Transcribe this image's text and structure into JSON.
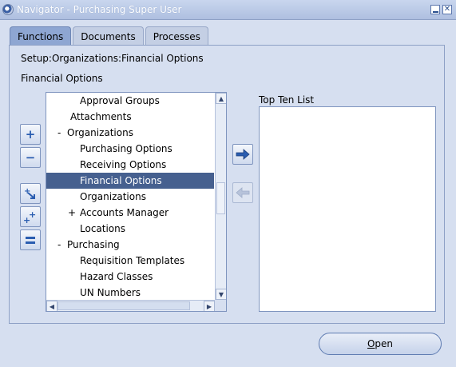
{
  "window": {
    "title": "Navigator - Purchasing Super User",
    "minimize_icon": "minimize-icon",
    "close_icon": "close-icon"
  },
  "tabs": [
    {
      "label": "Functions",
      "active": true
    },
    {
      "label": "Documents",
      "active": false
    },
    {
      "label": "Processes",
      "active": false
    }
  ],
  "breadcrumb": "Setup:Organizations:Financial Options",
  "section_label": "Financial Options",
  "side_buttons": [
    {
      "icon": "expand-plus-icon"
    },
    {
      "icon": "collapse-minus-icon"
    },
    {
      "icon": "expand-branch-icon"
    },
    {
      "icon": "expand-all-icon"
    },
    {
      "icon": "collapse-all-icon"
    }
  ],
  "tree": {
    "items": [
      {
        "label": "Approval Groups",
        "expander": ""
      },
      {
        "label": "Attachments",
        "expander": ""
      },
      {
        "label": "Organizations",
        "expander": "-"
      },
      {
        "label": "Purchasing Options",
        "expander": ""
      },
      {
        "label": "Receiving Options",
        "expander": ""
      },
      {
        "label": "Financial Options",
        "expander": "",
        "selected": true
      },
      {
        "label": "Organizations",
        "expander": ""
      },
      {
        "label": "Accounts Manager",
        "expander": "+"
      },
      {
        "label": "Locations",
        "expander": ""
      },
      {
        "label": "Purchasing",
        "expander": "-"
      },
      {
        "label": "Requisition Templates",
        "expander": ""
      },
      {
        "label": "Hazard Classes",
        "expander": ""
      },
      {
        "label": "UN Numbers",
        "expander": ""
      }
    ]
  },
  "add_to_list_icon": "arrow-right-icon",
  "remove_from_list_icon": "arrow-left-icon",
  "top_ten": {
    "label": "Top Ten List",
    "items": []
  },
  "open_button": {
    "mnemonic": "O",
    "rest": "pen"
  },
  "colors": {
    "background": "#d6dff0",
    "selected_row": "#46608f",
    "active_tab": "#8ea6d2"
  }
}
